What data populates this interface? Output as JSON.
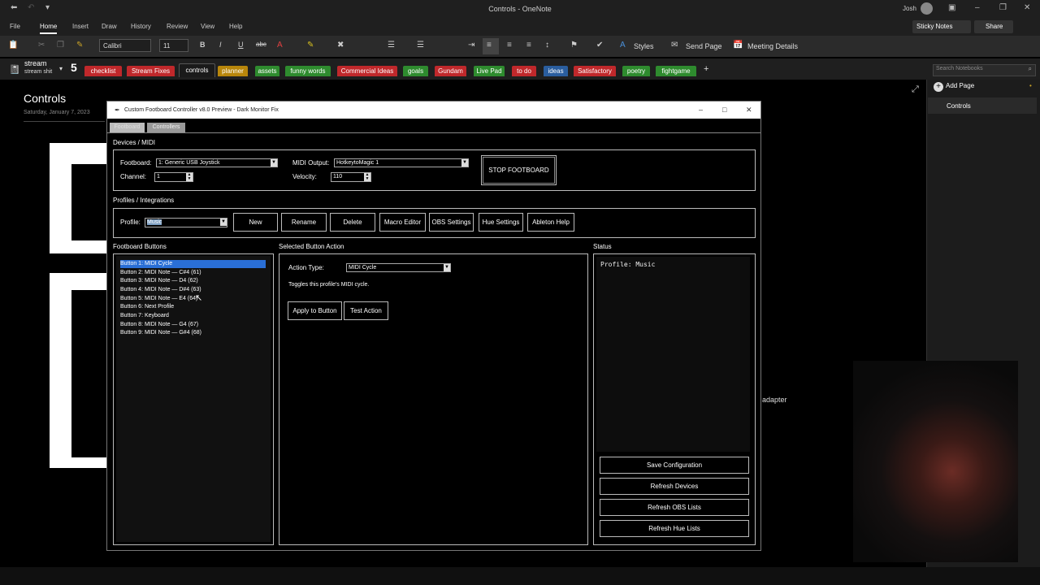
{
  "onenote": {
    "window_title": "Controls - OneNote",
    "user": "Josh",
    "menu": [
      "File",
      "Home",
      "Insert",
      "Draw",
      "History",
      "Review",
      "View",
      "Help"
    ],
    "menu_active": "Home",
    "font_name": "Calibri",
    "font_size": "11",
    "styles_label": "Styles",
    "send_page_label": "Send Page",
    "meeting_details_label": "Meeting Details",
    "sticky_notes_label": "Sticky Notes",
    "share_label": "Share",
    "notebook_name": "stream",
    "notebook_sub": "stream shit",
    "sections": [
      {
        "label": "checklist",
        "color": "#c0282b"
      },
      {
        "label": "Stream Fixes",
        "color": "#c0282b"
      },
      {
        "label": "controls",
        "color": "#1a1a1a"
      },
      {
        "label": "planner",
        "color": "#b8860b"
      },
      {
        "label": "assets",
        "color": "#2e8b2e"
      },
      {
        "label": "funny words",
        "color": "#2e8b2e"
      },
      {
        "label": "Commercial Ideas",
        "color": "#c0282b"
      },
      {
        "label": "goals",
        "color": "#2e8b2e"
      },
      {
        "label": "Gundam",
        "color": "#c0282b"
      },
      {
        "label": "Live Pad",
        "color": "#2e8b2e"
      },
      {
        "label": "to do",
        "color": "#c0282b"
      },
      {
        "label": "ideas",
        "color": "#2a5d9e"
      },
      {
        "label": "Satisfactory",
        "color": "#c0282b"
      },
      {
        "label": "poetry",
        "color": "#2e8b2e"
      },
      {
        "label": "fightgame",
        "color": "#2e8b2e"
      }
    ],
    "search_placeholder": "Search Notebooks",
    "add_page_label": "Add Page",
    "pages": [
      "Controls"
    ],
    "page_title": "Controls",
    "page_date": "Saturday, January 7, 2023",
    "partial_text": "adapter"
  },
  "dialog": {
    "title": "Custom Footboard Controller v8.0 Preview - Dark Monitor Fix",
    "tabs": [
      "Footboard",
      "Controllers"
    ],
    "devices": {
      "group_label": "Devices / MIDI",
      "footboard_label": "Footboard:",
      "footboard_value": "1: Generic USB Joystick",
      "midi_output_label": "MIDI Output:",
      "midi_output_value": "HotkeytoMagic 1",
      "channel_label": "Channel:",
      "channel_value": "1",
      "velocity_label": "Velocity:",
      "velocity_value": "110",
      "stop_button": "STOP FOOTBOARD"
    },
    "profiles": {
      "group_label": "Profiles / Integrations",
      "profile_label": "Profile:",
      "profile_value": "Music",
      "buttons": [
        "New",
        "Rename",
        "Delete",
        "Macro Editor",
        "OBS Settings",
        "Hue Settings",
        "Ableton Help"
      ]
    },
    "footboard_buttons": {
      "group_label": "Footboard Buttons",
      "items": [
        "Button 1: MIDI Cycle",
        "Button 2: MIDI Note — C#4 (61)",
        "Button 3: MIDI Note — D4 (62)",
        "Button 4: MIDI Note — D#4 (63)",
        "Button 5: MIDI Note — E4 (64)",
        "Button 6: Next Profile",
        "Button 7: Keyboard",
        "Button 8: MIDI Note — G4 (67)",
        "Button 9: MIDI Note — G#4 (68)"
      ],
      "selected_index": 0
    },
    "action": {
      "group_label": "Selected Button Action",
      "action_type_label": "Action Type:",
      "action_type_value": "MIDI Cycle",
      "description": "Toggles this profile's MIDI cycle.",
      "apply_button": "Apply to Button",
      "test_button": "Test Action"
    },
    "status": {
      "group_label": "Status",
      "text": "Profile: Music",
      "buttons": [
        "Save Configuration",
        "Refresh Devices",
        "Refresh OBS Lists",
        "Refresh Hue Lists"
      ]
    }
  }
}
